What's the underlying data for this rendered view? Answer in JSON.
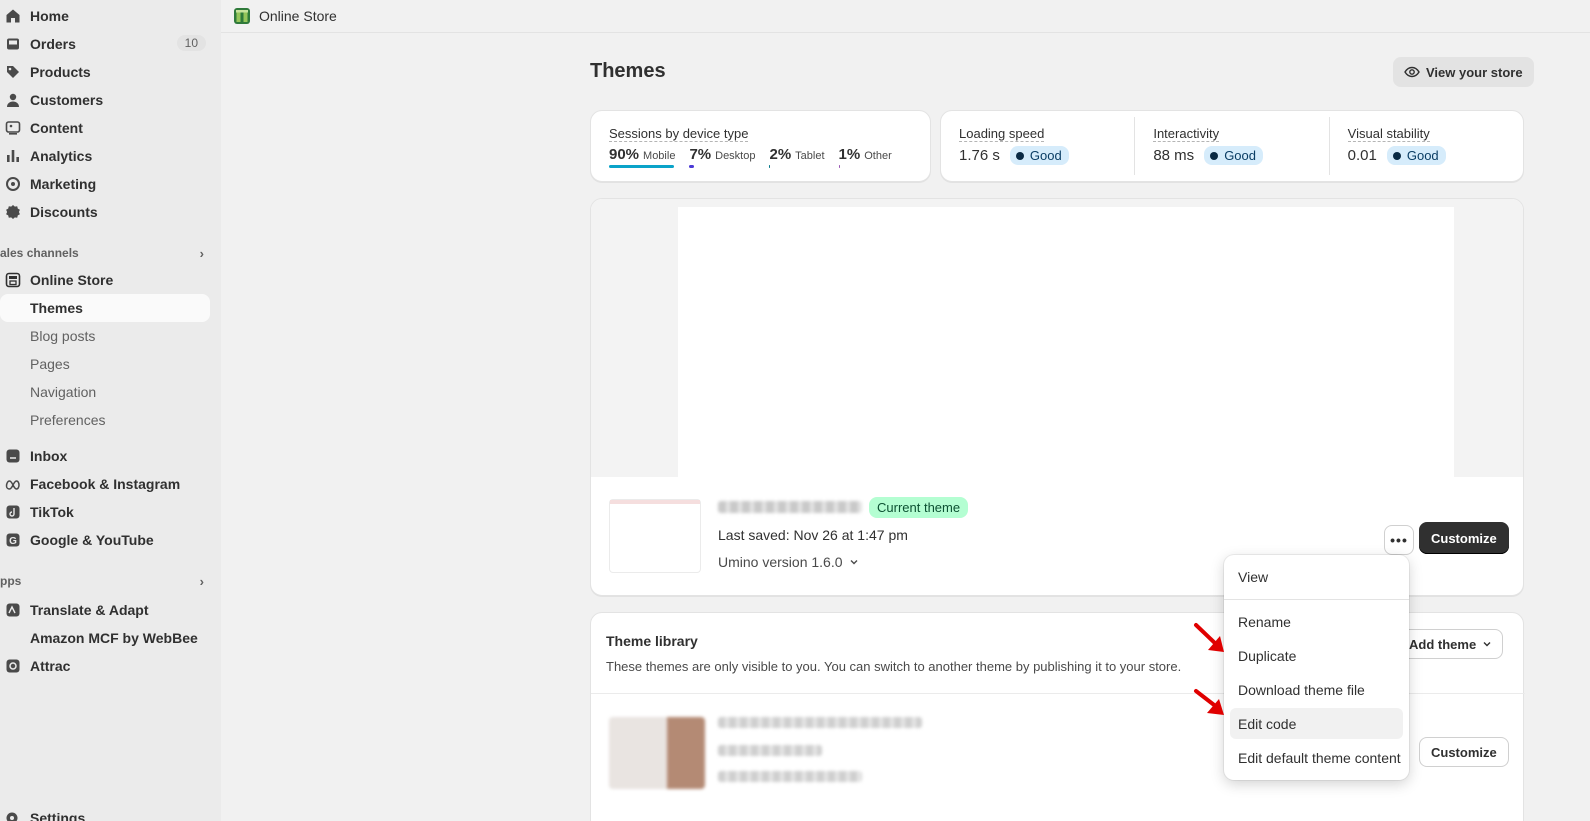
{
  "sidebar": {
    "items": [
      {
        "label": "Home",
        "icon": "home-icon"
      },
      {
        "label": "Orders",
        "icon": "orders-icon",
        "badge": "10"
      },
      {
        "label": "Products",
        "icon": "tag-icon"
      },
      {
        "label": "Customers",
        "icon": "person-icon"
      },
      {
        "label": "Content",
        "icon": "content-icon"
      },
      {
        "label": "Analytics",
        "icon": "analytics-icon"
      },
      {
        "label": "Marketing",
        "icon": "marketing-icon"
      },
      {
        "label": "Discounts",
        "icon": "discount-icon"
      }
    ],
    "sales_channels_label": "ales channels",
    "online_store": "Online Store",
    "sub_items": [
      "Themes",
      "Blog posts",
      "Pages",
      "Navigation",
      "Preferences"
    ],
    "channels": [
      "Inbox",
      "Facebook & Instagram",
      "TikTok",
      "Google & YouTube"
    ],
    "apps_label": "pps",
    "apps": [
      "Translate & Adapt",
      "Amazon MCF by WebBee",
      "Attrac"
    ],
    "settings": "Settings"
  },
  "topbar": {
    "crumb": "Online Store"
  },
  "page": {
    "title": "Themes",
    "view_store": "View your store"
  },
  "sessions": {
    "title": "Sessions by device type",
    "items": [
      {
        "pct": "90%",
        "label": "Mobile",
        "fill": 0.9
      },
      {
        "pct": "7%",
        "label": "Desktop",
        "fill": 0.07
      },
      {
        "pct": "2%",
        "label": "Tablet",
        "fill": 0.02
      },
      {
        "pct": "1%",
        "label": "Other",
        "fill": 0.01
      }
    ]
  },
  "metrics": [
    {
      "title": "Loading speed",
      "value": "1.76 s",
      "status": "Good"
    },
    {
      "title": "Interactivity",
      "value": "88 ms",
      "status": "Good"
    },
    {
      "title": "Visual stability",
      "value": "0.01",
      "status": "Good"
    }
  ],
  "current_theme": {
    "badge": "Current theme",
    "last_saved": "Last saved: Nov 26 at 1:47 pm",
    "version": "Umino version 1.6.0",
    "more": "•••",
    "customize": "Customize"
  },
  "library": {
    "title": "Theme library",
    "description": "These themes are only visible to you. You can switch to another theme by publishing it to your store.",
    "add_theme": "Add theme",
    "customize": "Customize"
  },
  "menu": {
    "items": [
      "View",
      "Rename",
      "Duplicate",
      "Download theme file",
      "Edit code",
      "Edit default theme content"
    ]
  },
  "colors": {
    "accent_dark": "#303030",
    "good_bg": "#d6ecfb",
    "current_badge_bg": "#b4fed2",
    "arrow": "#e00000"
  }
}
